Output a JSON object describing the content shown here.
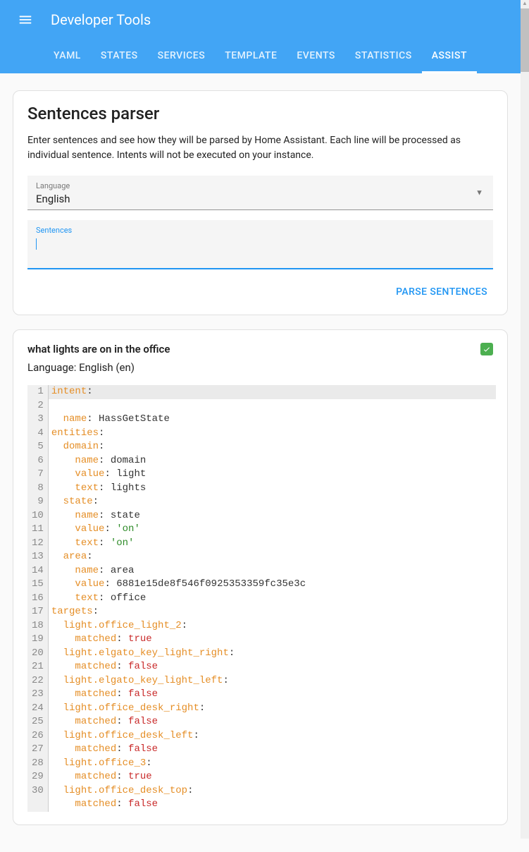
{
  "header": {
    "title": "Developer Tools"
  },
  "tabs": [
    "YAML",
    "STATES",
    "SERVICES",
    "TEMPLATE",
    "EVENTS",
    "STATISTICS",
    "ASSIST"
  ],
  "active_tab": "ASSIST",
  "parser": {
    "title": "Sentences parser",
    "description": "Enter sentences and see how they will be parsed by Home Assistant. Each line will be processed as individual sentence. Intents will not be executed on your instance.",
    "language_label": "Language",
    "language_value": "English",
    "sentences_label": "Sentences",
    "sentences_value": "",
    "parse_button": "PARSE SENTENCES"
  },
  "result": {
    "sentence": "what lights are on in the office",
    "language_line": "Language: English (en)",
    "yaml": {
      "intent": {
        "name": "HassGetState"
      },
      "entities": {
        "domain": {
          "name": "domain",
          "value": "light",
          "text": "lights"
        },
        "state": {
          "name": "state",
          "value": "'on'",
          "text": "'on'"
        },
        "area": {
          "name": "area",
          "value": "6881e15de8f546f0925353359fc35e3c",
          "text": "office"
        }
      },
      "targets": [
        {
          "id": "light.office_light_2",
          "matched": "true"
        },
        {
          "id": "light.elgato_key_light_right",
          "matched": "false"
        },
        {
          "id": "light.elgato_key_light_left",
          "matched": "false"
        },
        {
          "id": "light.office_desk_right",
          "matched": "false"
        },
        {
          "id": "light.office_desk_left",
          "matched": "false"
        },
        {
          "id": "light.office_3",
          "matched": "true"
        },
        {
          "id": "light.office_desk_top",
          "matched": "false"
        }
      ]
    }
  }
}
